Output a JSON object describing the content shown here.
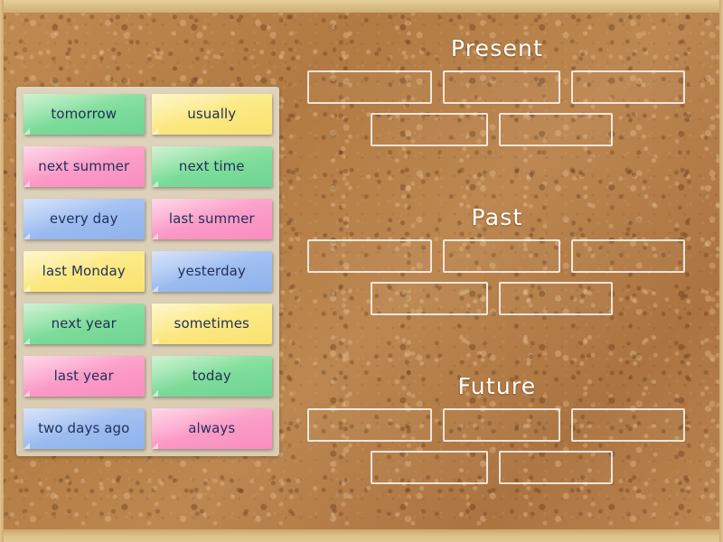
{
  "activity": {
    "type": "group-sort",
    "board_style": "cork-board"
  },
  "colors": {
    "green": "#7ddc9a",
    "yellow": "#fbe87f",
    "pink": "#fb9ac6",
    "blue": "#9cbcf0",
    "cork": "#b57f4a",
    "frame": "#dcc089",
    "tray": "#d8c9ae",
    "slot_border": "#ffffff",
    "heading_text": "#ffffff",
    "card_text": "#23305c"
  },
  "tray": {
    "name": "word-card-tray",
    "cards": [
      {
        "label": "tomorrow",
        "color": "green"
      },
      {
        "label": "usually",
        "color": "yellow"
      },
      {
        "label": "next summer",
        "color": "pink"
      },
      {
        "label": "next time",
        "color": "green"
      },
      {
        "label": "every day",
        "color": "blue"
      },
      {
        "label": "last summer",
        "color": "pink"
      },
      {
        "label": "last Monday",
        "color": "yellow"
      },
      {
        "label": "yesterday",
        "color": "blue"
      },
      {
        "label": "next year",
        "color": "green"
      },
      {
        "label": "sometimes",
        "color": "yellow"
      },
      {
        "label": "last year",
        "color": "pink"
      },
      {
        "label": "today",
        "color": "green"
      },
      {
        "label": "two days ago",
        "color": "blue"
      },
      {
        "label": "always",
        "color": "pink"
      }
    ]
  },
  "zones": [
    {
      "id": "present",
      "title": "Present",
      "rows": [
        {
          "slots": [
            "",
            "",
            ""
          ]
        },
        {
          "slots": [
            "",
            ""
          ]
        }
      ]
    },
    {
      "id": "past",
      "title": "Past",
      "rows": [
        {
          "slots": [
            "",
            "",
            ""
          ]
        },
        {
          "slots": [
            "",
            ""
          ]
        }
      ]
    },
    {
      "id": "future",
      "title": "Future",
      "rows": [
        {
          "slots": [
            "",
            "",
            ""
          ]
        },
        {
          "slots": [
            "",
            ""
          ]
        }
      ]
    }
  ]
}
